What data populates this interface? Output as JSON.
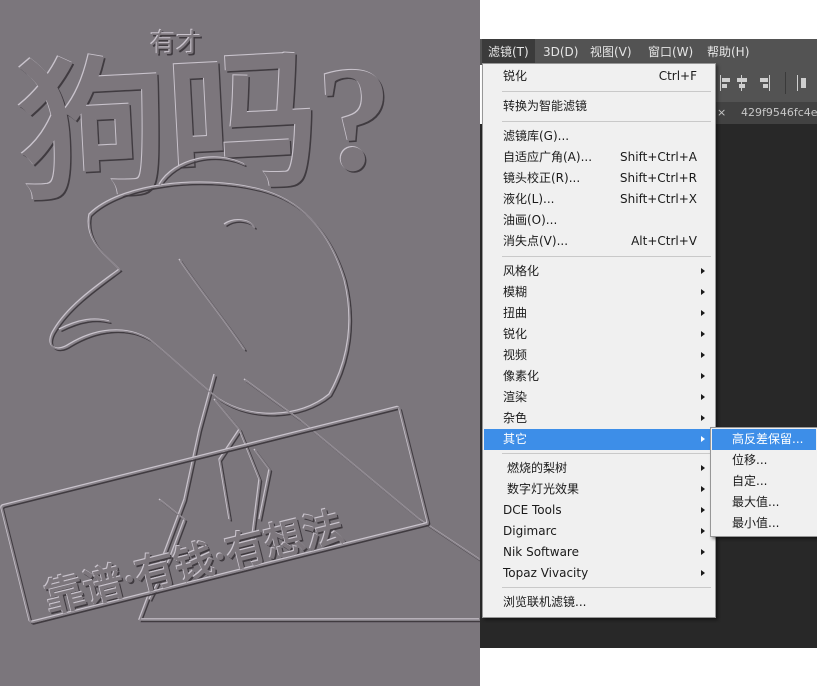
{
  "colors": {
    "highlight": "#3d8ee8",
    "menubar_bg": "#535353",
    "workspace_bg": "#282828",
    "canvas_bg": "#7b767c",
    "menu_bg": "#f0f0f0"
  },
  "menubar": {
    "items": [
      {
        "label": "滤镜(T)",
        "active": true
      },
      {
        "label": "3D(D)"
      },
      {
        "label": "视图(V)"
      },
      {
        "label": "窗口(W)"
      },
      {
        "label": "帮助(H)"
      }
    ]
  },
  "tab": {
    "label": "429f9546fc4e"
  },
  "tab_close_icon": "×",
  "artwork": {
    "headline": "狗吗?",
    "small_text": "有才",
    "banner_text": "靠谱·有钱·有想法"
  },
  "filter_menu": {
    "items": [
      {
        "label": "锐化",
        "shortcut": "Ctrl+F"
      },
      {
        "label": "转换为智能滤镜"
      },
      {
        "label": "滤镜库(G)..."
      },
      {
        "label": "自适应广角(A)...",
        "shortcut": "Shift+Ctrl+A"
      },
      {
        "label": "镜头校正(R)...",
        "shortcut": "Shift+Ctrl+R"
      },
      {
        "label": "液化(L)...",
        "shortcut": "Shift+Ctrl+X"
      },
      {
        "label": "油画(O)..."
      },
      {
        "label": "消失点(V)...",
        "shortcut": "Alt+Ctrl+V"
      },
      {
        "label": "风格化",
        "submenu": true
      },
      {
        "label": "模糊",
        "submenu": true
      },
      {
        "label": "扭曲",
        "submenu": true
      },
      {
        "label": "锐化",
        "submenu": true
      },
      {
        "label": "视频",
        "submenu": true
      },
      {
        "label": "像素化",
        "submenu": true
      },
      {
        "label": "渲染",
        "submenu": true
      },
      {
        "label": "杂色",
        "submenu": true
      },
      {
        "label": "其它",
        "submenu": true,
        "highlighted": true
      },
      {
        "label": "燃烧的梨树",
        "submenu": true
      },
      {
        "label": "数字灯光效果",
        "submenu": true
      },
      {
        "label": "DCE Tools",
        "submenu": true
      },
      {
        "label": "Digimarc",
        "submenu": true
      },
      {
        "label": "Nik Software",
        "submenu": true
      },
      {
        "label": "Topaz Vivacity",
        "submenu": true
      },
      {
        "label": "浏览联机滤镜..."
      }
    ]
  },
  "other_submenu": {
    "items": [
      {
        "label": "高反差保留...",
        "highlighted": true
      },
      {
        "label": "位移..."
      },
      {
        "label": "自定..."
      },
      {
        "label": "最大值..."
      },
      {
        "label": "最小值..."
      }
    ]
  }
}
